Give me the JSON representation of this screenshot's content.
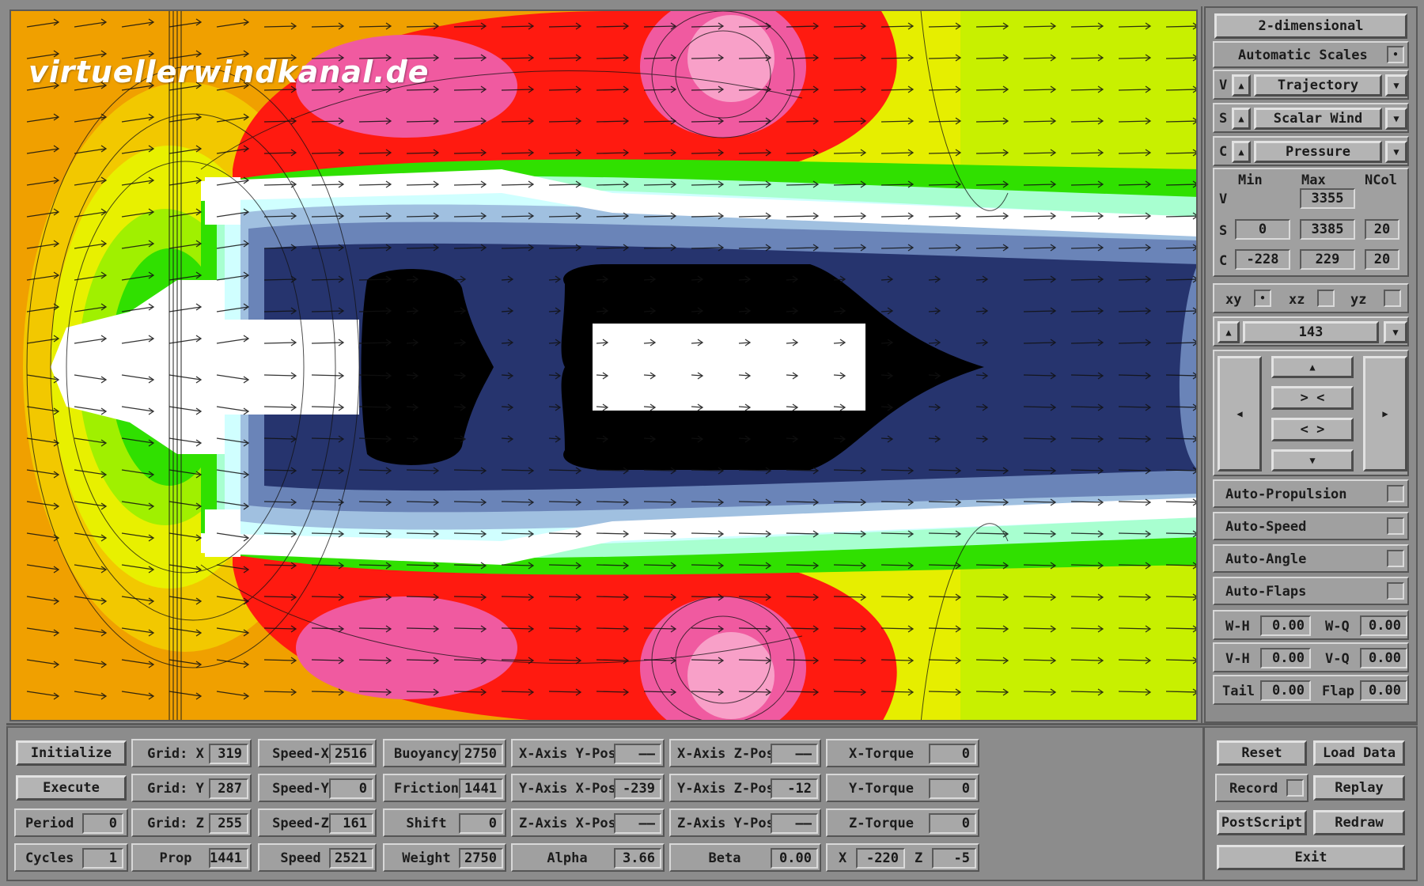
{
  "watermark": "virtuellerwindkanal.de",
  "right_panel": {
    "mode": "2-dimensional",
    "scales": "Automatic Scales",
    "scales_checked": true,
    "v_label": "V",
    "v_value": "Trajectory",
    "s_label": "S",
    "s_value": "Scalar Wind",
    "c_label": "C",
    "c_value": "Pressure",
    "range_headers": [
      "Min",
      "Max",
      "NCol"
    ],
    "v_row": {
      "label": "V",
      "max": "3355"
    },
    "s_row": {
      "label": "S",
      "min": "0",
      "max": "3385",
      "ncol": "20"
    },
    "c_row": {
      "label": "C",
      "min": "-228",
      "max": "229",
      "ncol": "20"
    },
    "planes": [
      {
        "label": "xy",
        "checked": true
      },
      {
        "label": "xz",
        "checked": false
      },
      {
        "label": "yz",
        "checked": false
      }
    ],
    "slice": "143",
    "nav": {
      "up": "▲",
      "zoom_in": "> <",
      "zoom_out": "< >",
      "down": "▼",
      "left": "◀",
      "right": "▶"
    },
    "auto": [
      "Auto-Propulsion",
      "Auto-Speed",
      "Auto-Angle",
      "Auto-Flaps"
    ],
    "trim": [
      {
        "l1": "W-H",
        "v1": "0.00",
        "l2": "W-Q",
        "v2": "0.00"
      },
      {
        "l1": "V-H",
        "v1": "0.00",
        "l2": "V-Q",
        "v2": "0.00"
      },
      {
        "l1": "Tail",
        "v1": "0.00",
        "l2": "Flap",
        "v2": "0.00"
      }
    ]
  },
  "bottom": {
    "col1": [
      {
        "type": "btn",
        "label": "Initialize"
      },
      {
        "type": "btn",
        "label": "Execute"
      },
      {
        "type": "field",
        "label": "Period",
        "value": "0"
      },
      {
        "type": "field",
        "label": "Cycles",
        "value": "1"
      }
    ],
    "col2": [
      {
        "label": "Grid: X",
        "value": "319"
      },
      {
        "label": "Grid: Y",
        "value": "287"
      },
      {
        "label": "Grid: Z",
        "value": "255"
      },
      {
        "label": "Prop",
        "value": "1441"
      }
    ],
    "col3": [
      {
        "label": "Speed-X",
        "value": "2516"
      },
      {
        "label": "Speed-Y",
        "value": "0"
      },
      {
        "label": "Speed-Z",
        "value": "161"
      },
      {
        "label": "Speed",
        "value": "2521"
      }
    ],
    "col4": [
      {
        "label": "Buoyancy",
        "value": "2750"
      },
      {
        "label": "Friction",
        "value": "1441"
      },
      {
        "label": "Shift",
        "value": "0"
      },
      {
        "label": "Weight",
        "value": "2750"
      }
    ],
    "col5": [
      {
        "label": "X-Axis Y-Pos",
        "value": "——"
      },
      {
        "label": "Y-Axis X-Pos",
        "value": "-239"
      },
      {
        "label": "Z-Axis X-Pos",
        "value": "——"
      },
      {
        "label": "Alpha",
        "value": "3.66"
      }
    ],
    "col6": [
      {
        "label": "X-Axis Z-Pos",
        "value": "——"
      },
      {
        "label": "Y-Axis Z-Pos",
        "value": "-12"
      },
      {
        "label": "Z-Axis Y-Pos",
        "value": "——"
      },
      {
        "label": "Beta",
        "value": "0.00"
      }
    ],
    "col7": [
      {
        "label": "X-Torque",
        "value": "0"
      },
      {
        "label": "Y-Torque",
        "value": "0"
      },
      {
        "label": "Z-Torque",
        "value": "0"
      }
    ],
    "xz": {
      "x_label": "X",
      "x_value": "-220",
      "z_label": "Z",
      "z_value": "-5"
    },
    "actions": {
      "reset": "Reset",
      "load": "Load Data",
      "record": "Record",
      "replay": "Replay",
      "postscript": "PostScript",
      "redraw": "Redraw",
      "exit": "Exit"
    }
  },
  "colors": {
    "orange": "#f0a000",
    "yellow": "#e8f000",
    "green": "#20e000",
    "red": "#ff1010",
    "pink": "#f05aa0",
    "navy": "#26346e",
    "panel": "#8c8c8c"
  }
}
